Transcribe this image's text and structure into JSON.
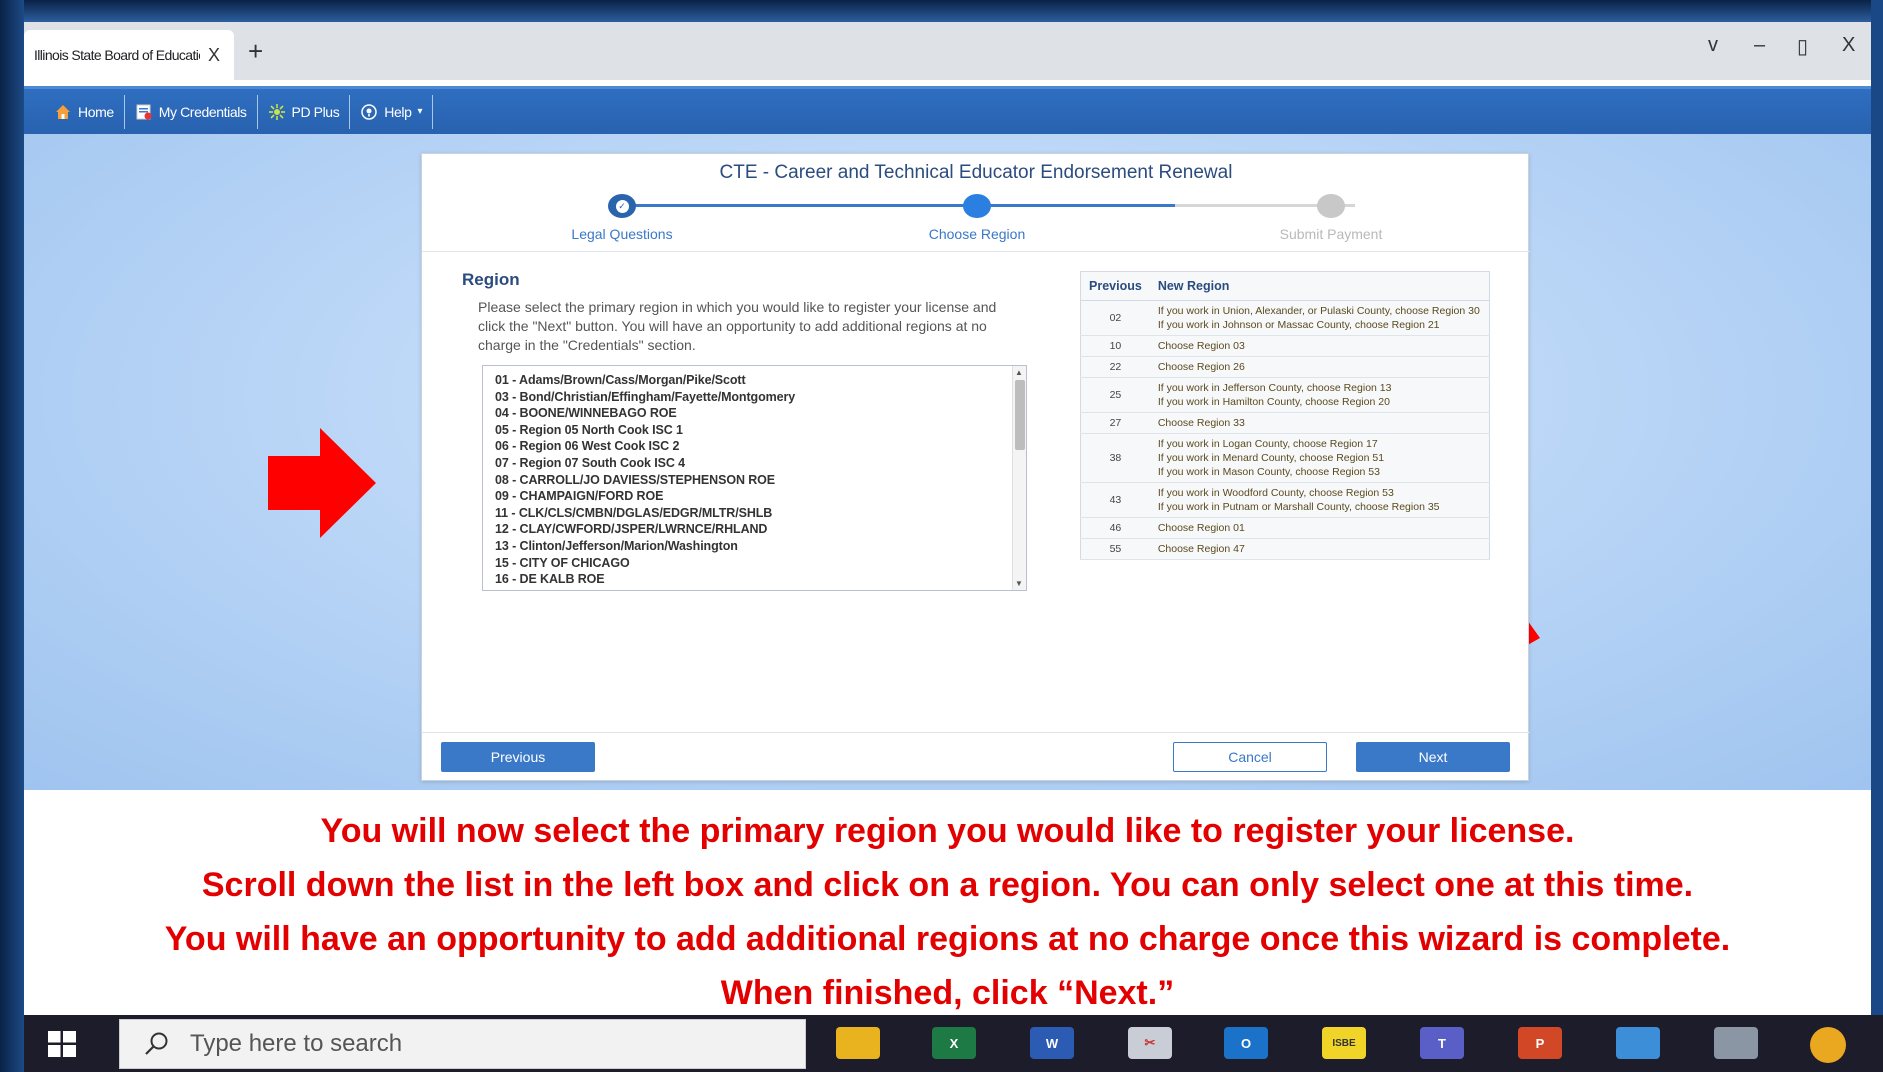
{
  "browser": {
    "tab_title": "Illinois State Board of Education",
    "tab_close": "X",
    "new_tab": "+",
    "controls": {
      "chevron": "v",
      "minimize": "–",
      "restore": "▯",
      "close": "X"
    }
  },
  "nav": {
    "items": [
      {
        "label": "Home",
        "icon": "home-icon"
      },
      {
        "label": "My Credentials",
        "icon": "credentials-icon"
      },
      {
        "label": "PD Plus",
        "icon": "pd-plus-icon"
      },
      {
        "label": "Help",
        "icon": "help-icon"
      }
    ]
  },
  "wizard": {
    "title": "CTE - Career and Technical Educator Endorsement Renewal",
    "steps": [
      {
        "label": "Legal Questions",
        "state": "done"
      },
      {
        "label": "Choose Region",
        "state": "current"
      },
      {
        "label": "Submit Payment",
        "state": "pending"
      }
    ],
    "region_heading": "Region",
    "region_desc": "Please select the primary region in which you would like to register your license and click the \"Next\" button. You will have an opportunity to add additional regions at no charge in the \"Credentials\" section.",
    "regions": [
      "01 - Adams/Brown/Cass/Morgan/Pike/Scott",
      "03 - Bond/Christian/Effingham/Fayette/Montgomery",
      "04 - BOONE/WINNEBAGO ROE",
      "05 - Region 05 North Cook ISC 1",
      "06 - Region 06 West Cook ISC 2",
      "07 - Region 07 South Cook ISC 4",
      "08 - CARROLL/JO DAVIESS/STEPHENSON ROE",
      "09 - CHAMPAIGN/FORD ROE",
      "11 - CLK/CLS/CMBN/DGLAS/EDGR/MLTR/SHLB",
      "12 - CLAY/CWFORD/JSPER/LWRNCE/RHLAND",
      "13 - Clinton/Jefferson/Marion/Washington",
      "15 - CITY OF CHICAGO",
      "16 - DE KALB ROE"
    ],
    "table": {
      "headers": [
        "Previous",
        "New Region"
      ],
      "rows": [
        {
          "prev": "02",
          "text": [
            "If you work in Union, Alexander, or Pulaski County, choose Region 30",
            "If you work in Johnson or Massac County, choose Region 21"
          ]
        },
        {
          "prev": "10",
          "text": [
            "Choose Region 03"
          ]
        },
        {
          "prev": "22",
          "text": [
            "Choose Region 26"
          ]
        },
        {
          "prev": "25",
          "text": [
            "If you work in Jefferson County, choose Region 13",
            "If you work in Hamilton County, choose Region 20"
          ]
        },
        {
          "prev": "27",
          "text": [
            "Choose Region 33"
          ]
        },
        {
          "prev": "38",
          "text": [
            "If you work in Logan County, choose Region 17",
            "If you work in Menard County, choose Region 51",
            "If you work in Mason County, choose Region 53"
          ]
        },
        {
          "prev": "43",
          "text": [
            "If you work in Woodford County, choose Region 53",
            "If you work in Putnam or Marshall County, choose Region 35"
          ]
        },
        {
          "prev": "46",
          "text": [
            "Choose Region 01"
          ]
        },
        {
          "prev": "55",
          "text": [
            "Choose Region 47"
          ]
        }
      ]
    },
    "buttons": {
      "previous": "Previous",
      "cancel": "Cancel",
      "next": "Next"
    }
  },
  "caption": {
    "lines": [
      "You will now select the primary region you would like to register your license.",
      "Scroll down the list in the left box and click on a region.  You can only select one at this time.",
      "You will have an opportunity to add additional regions at no charge once this wizard is complete.",
      "When finished, click “Next.”"
    ]
  },
  "taskbar": {
    "search_placeholder": "Type here to search",
    "apps": [
      "file-explorer-icon",
      "excel-icon",
      "word-icon",
      "snipping-tool-icon",
      "outlook-icon",
      "isbe-icon",
      "teams-icon",
      "powerpoint-icon",
      "remote-desktop-icon",
      "calculator-icon",
      "chrome-icon"
    ],
    "isbe_label": "ISBE"
  },
  "colors": {
    "accent": "#3a78c8",
    "nav": "#2862b0",
    "caption_red": "#e30000",
    "arrow_red": "#ff0000"
  }
}
